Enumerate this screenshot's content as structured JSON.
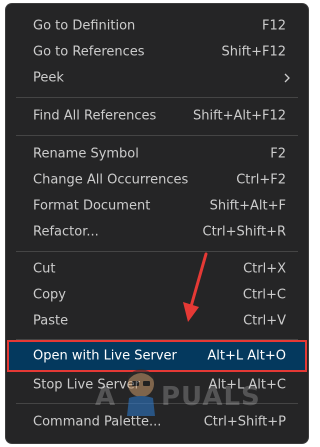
{
  "menu": {
    "items": [
      {
        "label": "Go to Definition",
        "shortcut": "F12"
      },
      {
        "label": "Go to References",
        "shortcut": "Shift+F12"
      },
      {
        "label": "Peek",
        "shortcut": ""
      },
      {
        "label": "Find All References",
        "shortcut": "Shift+Alt+F12"
      },
      {
        "label": "Rename Symbol",
        "shortcut": "F2"
      },
      {
        "label": "Change All Occurrences",
        "shortcut": "Ctrl+F2"
      },
      {
        "label": "Format Document",
        "shortcut": "Shift+Alt+F"
      },
      {
        "label": "Refactor...",
        "shortcut": "Ctrl+Shift+R"
      },
      {
        "label": "Cut",
        "shortcut": "Ctrl+X"
      },
      {
        "label": "Copy",
        "shortcut": "Ctrl+C"
      },
      {
        "label": "Paste",
        "shortcut": "Ctrl+V"
      },
      {
        "label": "Open with Live Server",
        "shortcut": "Alt+L Alt+O"
      },
      {
        "label": "Stop Live Server",
        "shortcut": "Alt+L Alt+C"
      },
      {
        "label": "Command Palette...",
        "shortcut": "Ctrl+Shift+P"
      }
    ],
    "submenu_icon": "chevron-right-icon"
  },
  "annotation": {
    "arrow_icon": "red-arrow-icon",
    "highlight_color": "#e53935"
  },
  "watermark": {
    "text_left": "A",
    "text_right": "PUALS"
  },
  "colors": {
    "menu_bg": "#252526",
    "text": "#cccccc",
    "selected_bg": "#04395e"
  }
}
